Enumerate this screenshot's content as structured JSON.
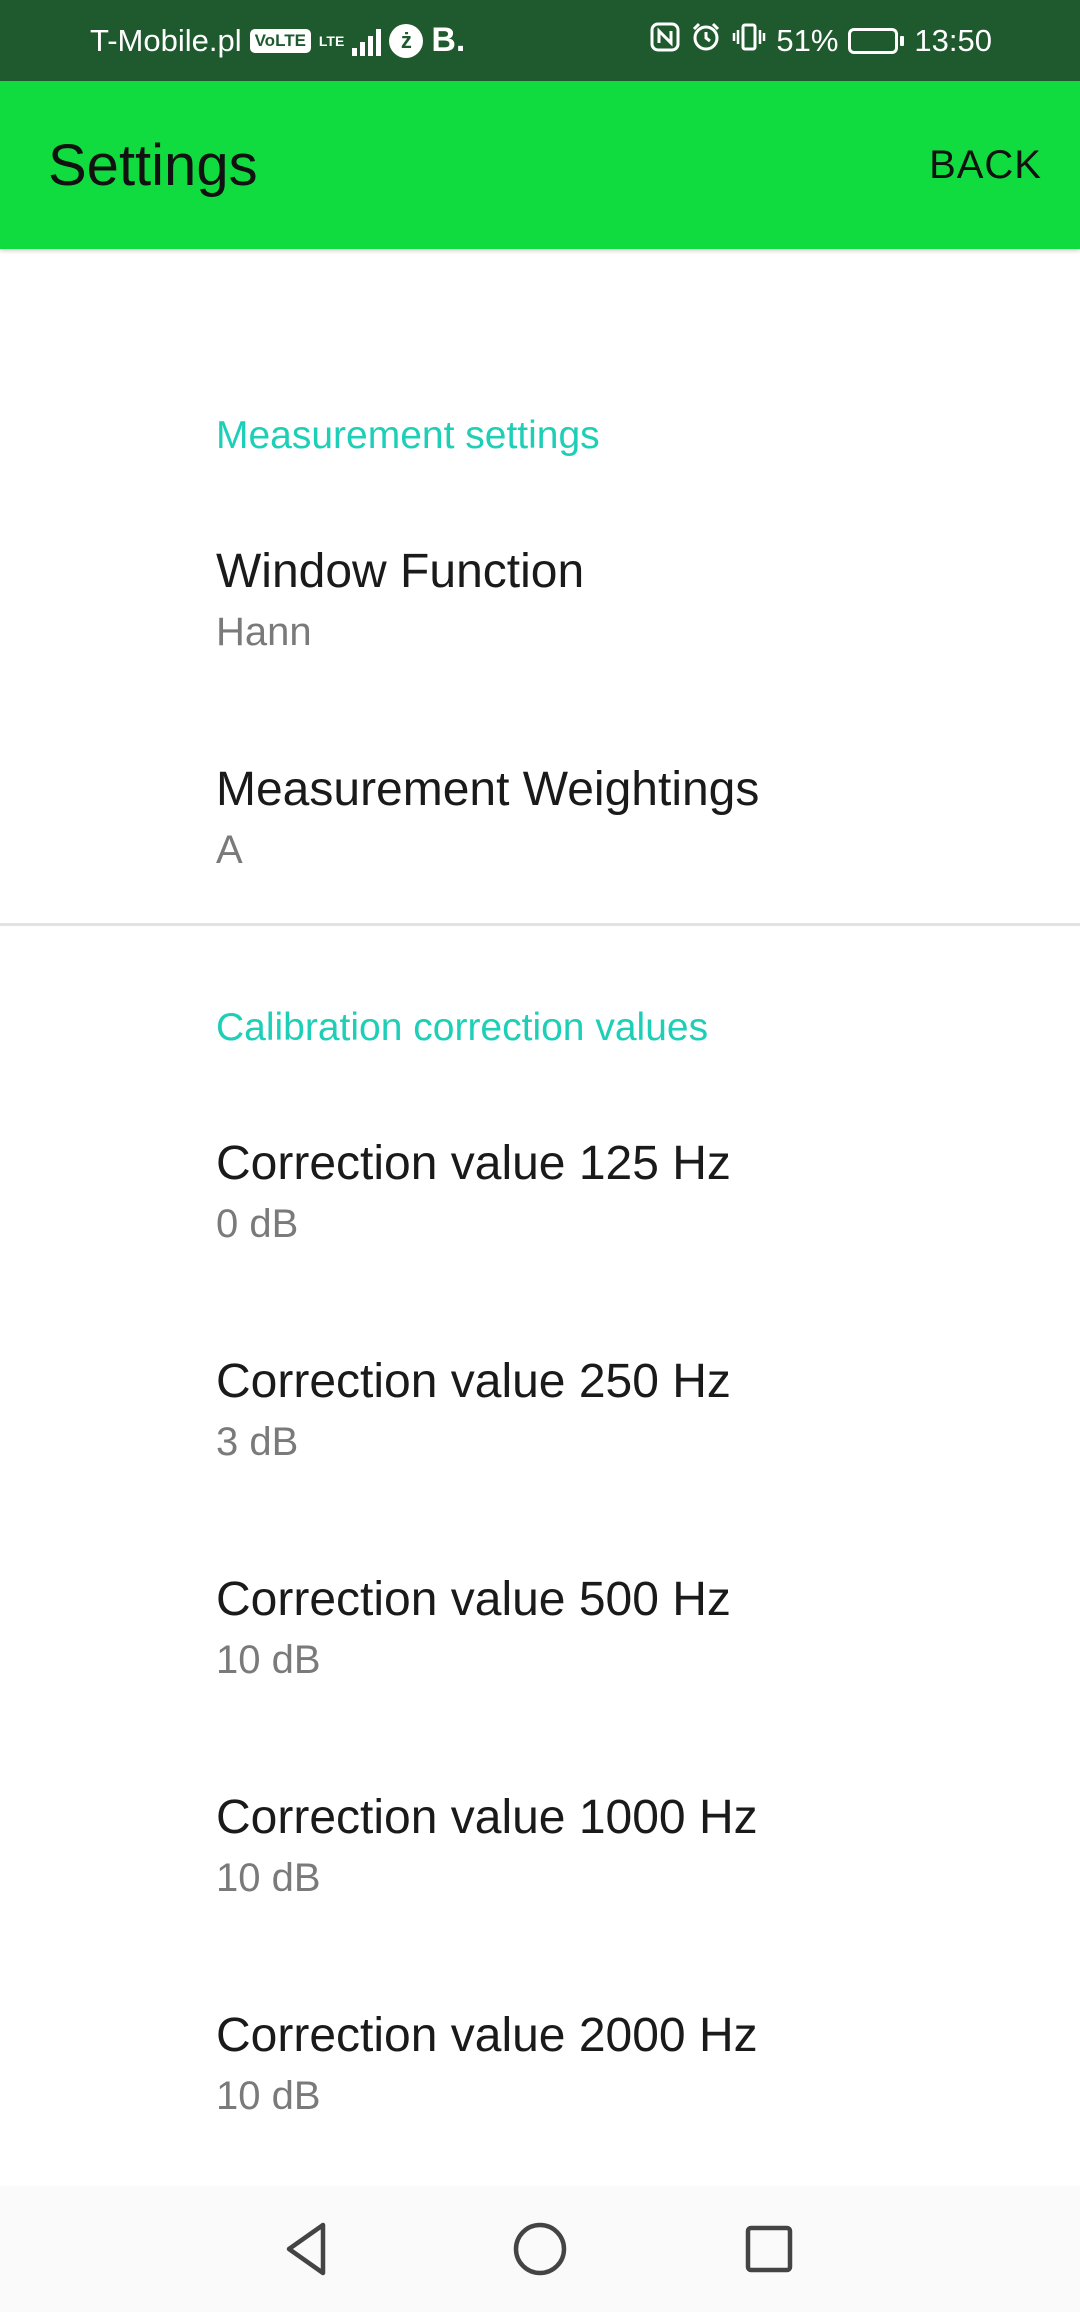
{
  "status_bar": {
    "carrier": "T-Mobile.pl",
    "volte": "VoLTE",
    "lte": "LTE",
    "battery_percent": "51%",
    "battery_level": 0.51,
    "time": "13:50"
  },
  "app_bar": {
    "title": "Settings",
    "back_label": "BACK",
    "color": "#10dc3f"
  },
  "sections": [
    {
      "header": "Measurement settings",
      "items": [
        {
          "title": "Window Function",
          "summary": "Hann"
        },
        {
          "title": "Measurement Weightings",
          "summary": "A"
        }
      ]
    },
    {
      "header": "Calibration correction values",
      "items": [
        {
          "title": "Correction value 125 Hz",
          "summary": "0 dB"
        },
        {
          "title": "Correction value 250 Hz",
          "summary": "3 dB"
        },
        {
          "title": "Correction value 500 Hz",
          "summary": "10 dB"
        },
        {
          "title": "Correction value 1000 Hz",
          "summary": "10 dB"
        },
        {
          "title": "Correction value 2000 Hz",
          "summary": "10 dB"
        }
      ]
    }
  ],
  "nav_bar": {
    "icons": [
      "back-triangle-icon",
      "home-circle-icon",
      "recents-square-icon"
    ]
  }
}
